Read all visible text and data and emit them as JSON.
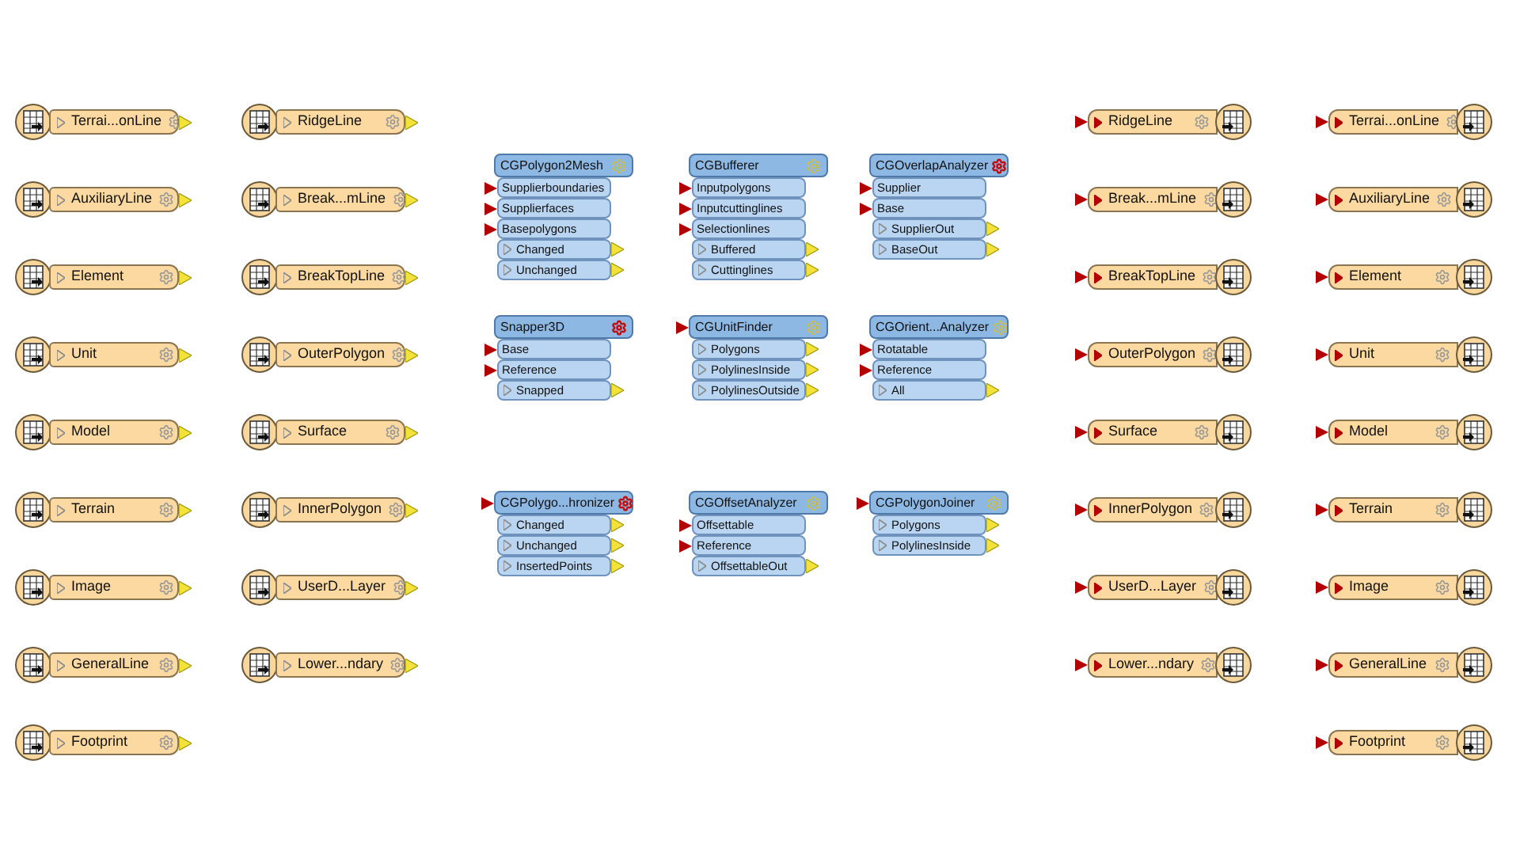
{
  "readers": [
    [
      "Terrai...onLine",
      "AuxiliaryLine",
      "Element",
      "Unit",
      "Model",
      "Terrain",
      "Image",
      "GeneralLine",
      "Footprint"
    ],
    [
      "RidgeLine",
      "Break...mLine",
      "BreakTopLine",
      "OuterPolygon",
      "Surface",
      "InnerPolygon",
      "UserD...Layer",
      "Lower...ndary"
    ]
  ],
  "transformers": [
    [
      {
        "name": "CGPolygon2Mesh",
        "incomplete": false,
        "header_input": false,
        "inputs": [
          "Supplierboundaries",
          "Supplierfaces",
          "Basepolygons"
        ],
        "outputs": [
          "Changed",
          "Unchanged"
        ]
      },
      {
        "name": "CGBufferer",
        "incomplete": false,
        "header_input": false,
        "inputs": [
          "Inputpolygons",
          "Inputcuttinglines",
          "Selectionlines"
        ],
        "outputs": [
          "Buffered",
          "Cuttinglines"
        ]
      },
      {
        "name": "CGOverlapAnalyzer",
        "incomplete": true,
        "header_input": false,
        "inputs": [
          "Supplier",
          "Base"
        ],
        "outputs": [
          "SupplierOut",
          "BaseOut"
        ]
      }
    ],
    [
      {
        "name": "Snapper3D",
        "incomplete": true,
        "header_input": false,
        "inputs": [
          "Base",
          "Reference"
        ],
        "outputs": [
          "Snapped"
        ]
      },
      {
        "name": "CGUnitFinder",
        "incomplete": false,
        "header_input": true,
        "outputs": [
          "Polygons",
          "PolylinesInside",
          "PolylinesOutside"
        ]
      },
      {
        "name": "CGOrient...Analyzer",
        "incomplete": false,
        "header_input": false,
        "inputs": [
          "Rotatable",
          "Reference"
        ],
        "outputs": [
          "All"
        ]
      }
    ],
    [
      {
        "name": "CGPolygo...hronizer",
        "incomplete": true,
        "header_input": true,
        "outputs": [
          "Changed",
          "Unchanged",
          "InsertedPoints"
        ]
      },
      {
        "name": "CGOffsetAnalyzer",
        "incomplete": false,
        "header_input": false,
        "inputs": [
          "Offsettable",
          "Reference"
        ],
        "outputs": [
          "OffsettableOut"
        ]
      },
      {
        "name": "CGPolygonJoiner",
        "incomplete": false,
        "header_input": true,
        "outputs": [
          "Polygons",
          "PolylinesInside"
        ]
      }
    ]
  ],
  "writers": [
    [
      "RidgeLine",
      "Break...mLine",
      "BreakTopLine",
      "OuterPolygon",
      "Surface",
      "InnerPolygon",
      "UserD...Layer",
      "Lower...ndary"
    ],
    [
      "Terrai...onLine",
      "AuxiliaryLine",
      "Element",
      "Unit",
      "Model",
      "Terrain",
      "Image",
      "GeneralLine",
      "Footprint"
    ]
  ]
}
